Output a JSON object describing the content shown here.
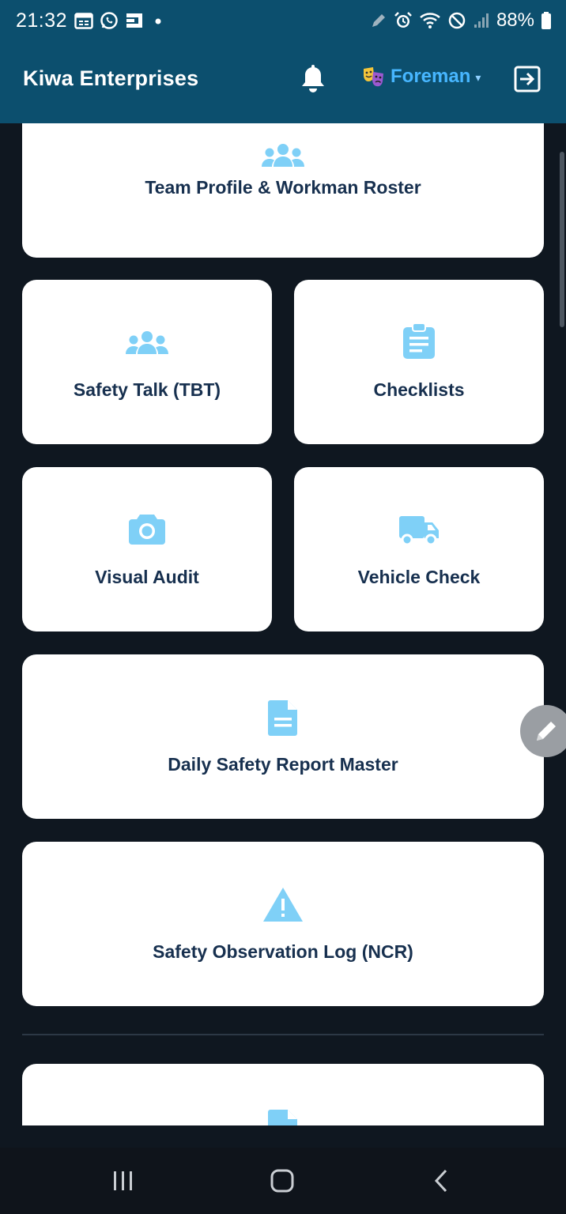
{
  "status_bar": {
    "time": "21:32",
    "battery": "88%",
    "left_icons": [
      "calendar-icon",
      "whatsapp-icon",
      "app-icon",
      "dot-icon"
    ],
    "right_icons": [
      "pen-icon",
      "alarm-icon",
      "wifi-icon",
      "do-not-disturb-icon",
      "signal-icon",
      "battery-icon"
    ]
  },
  "header": {
    "title": "Kiwa Enterprises",
    "role": "Foreman",
    "role_caret": "▾",
    "icons": [
      "bell-icon",
      "masks-icon",
      "logout-icon"
    ]
  },
  "tiles": [
    {
      "label": "Team Profile & Workman Roster",
      "icon": "team-icon"
    },
    {
      "label": "Safety Talk (TBT)",
      "icon": "team-icon"
    },
    {
      "label": "Checklists",
      "icon": "clipboard-icon"
    },
    {
      "label": "Visual Audit",
      "icon": "camera-icon"
    },
    {
      "label": "Vehicle Check",
      "icon": "truck-icon"
    },
    {
      "label": "Daily Safety Report Master",
      "icon": "document-icon"
    },
    {
      "label": "Safety Observation Log (NCR)",
      "icon": "warning-icon"
    },
    {
      "label": "",
      "icon": "document-icon"
    }
  ],
  "colors": {
    "header_bg": "#0c4f6e",
    "page_bg": "#0f1720",
    "card_bg": "#ffffff",
    "card_text": "#17304f",
    "icon_accent": "#7fd0f7",
    "role_accent": "#47b6ff"
  },
  "nav": [
    "recent-apps-icon",
    "home-icon",
    "back-icon"
  ]
}
